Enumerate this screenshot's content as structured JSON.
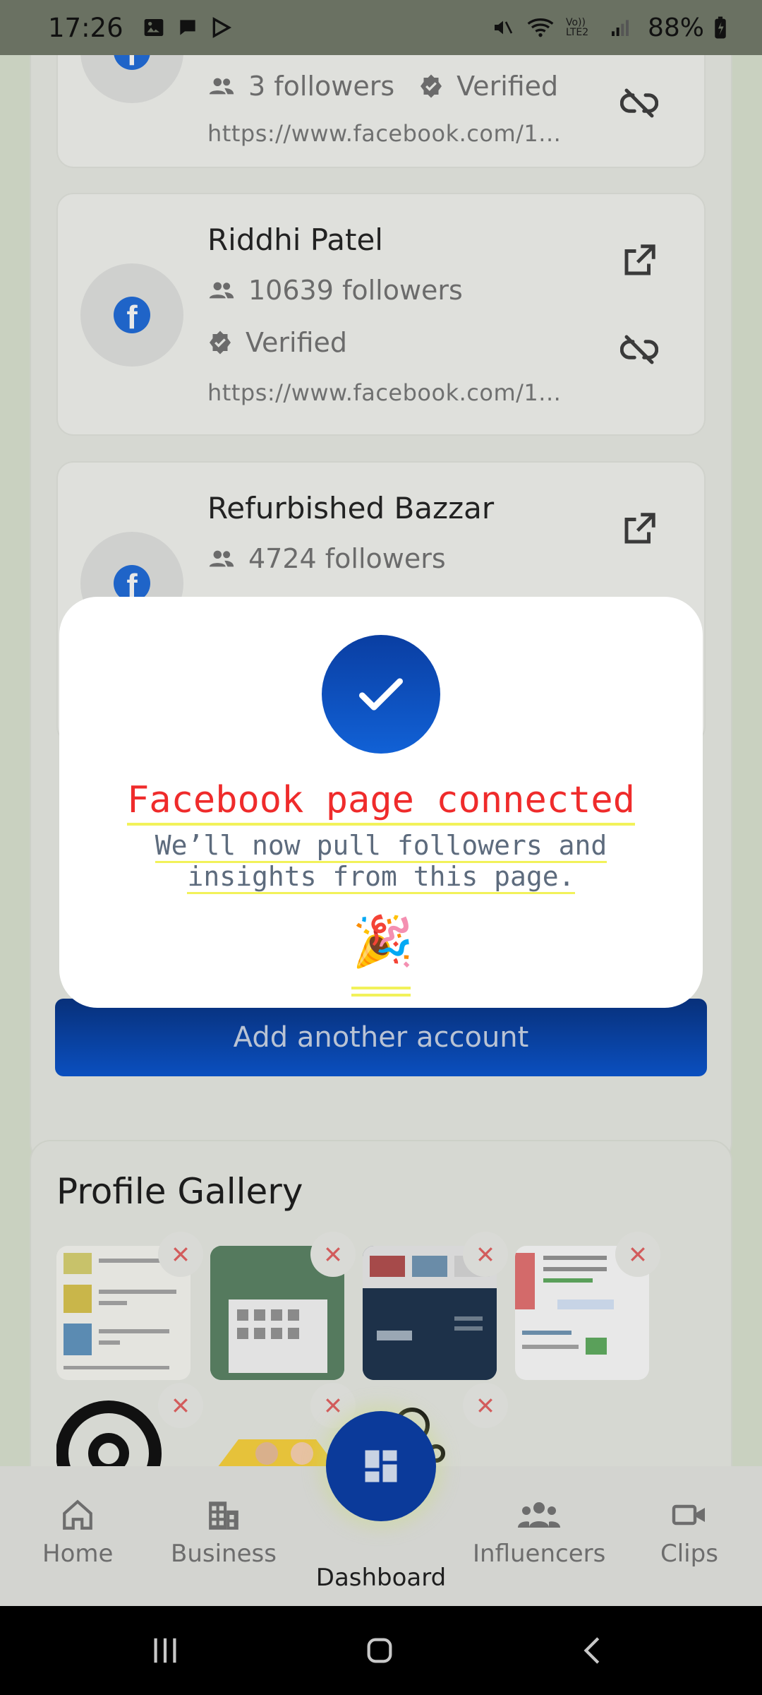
{
  "status_bar": {
    "time": "17:26",
    "battery": "88%",
    "network_label": "Vo)) LTE2"
  },
  "accounts": [
    {
      "name": "",
      "followers": "3 followers",
      "verified": "Verified",
      "url": "https://www.facebook.com/1..."
    },
    {
      "name": "Riddhi Patel",
      "followers": "10639 followers",
      "verified": "Verified",
      "url": "https://www.facebook.com/1..."
    },
    {
      "name": "Refurbished Bazzar",
      "followers": "4724 followers"
    }
  ],
  "add_account_label": "Add another account",
  "gallery": {
    "title": "Profile Gallery"
  },
  "modal": {
    "title": "Facebook page connected",
    "subtitle": "We’ll now pull followers and insights from this page.",
    "emoji": "🎉"
  },
  "nav": {
    "home": "Home",
    "business": "Business",
    "dashboard": "Dashboard",
    "influencers": "Influencers",
    "clips": "Clips"
  },
  "colors": {
    "accent_blue": "#0b3a9a",
    "modal_title_red": "#ef2b2b",
    "highlight_yellow": "#f2f25a"
  }
}
